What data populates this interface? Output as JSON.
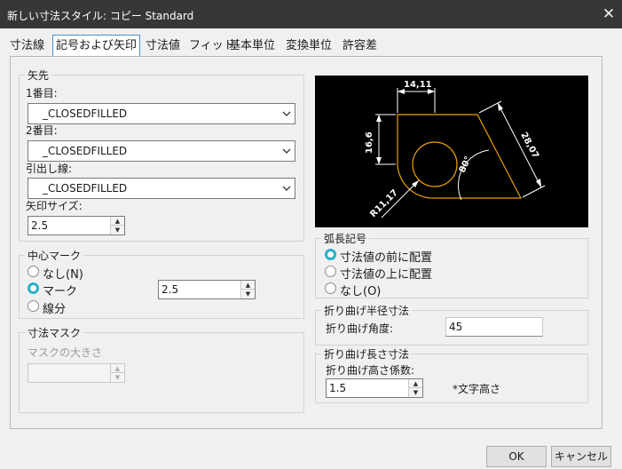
{
  "window": {
    "title": "新しい寸法スタイル: コピー Standard",
    "close_glyph": "✕"
  },
  "tabs": [
    "寸法線",
    "記号および矢印",
    "寸法値",
    "フィット",
    "基本単位",
    "変換単位",
    "許容差"
  ],
  "arrows": {
    "group_label": "矢先",
    "first_label": "1番目:",
    "first_value": "_CLOSEDFILLED",
    "second_label": "2番目:",
    "second_value": "_CLOSEDFILLED",
    "leader_label": "引出し線:",
    "leader_value": "_CLOSEDFILLED",
    "size_label": "矢印サイズ:",
    "size_value": "2.5"
  },
  "center_mark": {
    "group_label": "中心マーク",
    "options": [
      "なし(N)",
      "マーク",
      "線分"
    ],
    "selected": "マーク",
    "size_value": "2.5"
  },
  "dim_mask": {
    "group_label": "寸法マスク",
    "size_label": "マスクの大きさ",
    "size_value": ""
  },
  "preview": {
    "dim_top": "14,11",
    "dim_left": "16,6",
    "dim_right": "28,07",
    "dim_angle": "80°",
    "dim_radius": "R11,17",
    "accent_color": "#f0a000"
  },
  "arc_length": {
    "group_label": "弧長記号",
    "options": [
      "寸法値の前に配置",
      "寸法値の上に配置",
      "なし(O)"
    ],
    "selected": "寸法値の前に配置"
  },
  "jog_radius": {
    "group_label": "折り曲げ半径寸法",
    "angle_label": "折り曲げ角度:",
    "angle_value": "45"
  },
  "jog_linear": {
    "group_label": "折り曲げ長さ寸法",
    "factor_label": "折り曲げ高さ係数:",
    "factor_value": "1.5",
    "unit_label": "*文字高さ"
  },
  "buttons": {
    "ok": "OK",
    "cancel": "キャンセル"
  }
}
